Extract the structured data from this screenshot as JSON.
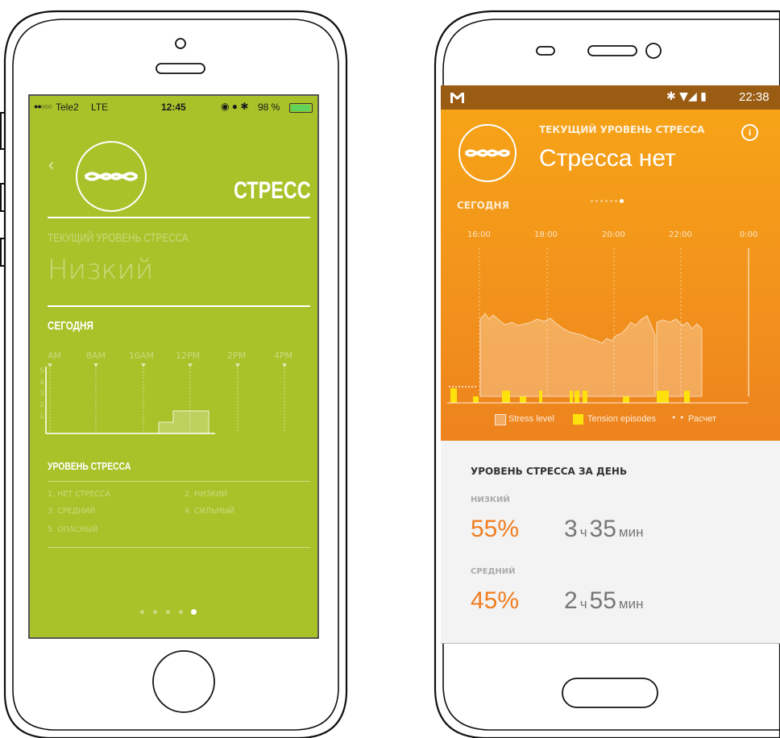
{
  "ios": {
    "status": {
      "carrier": "Tele2",
      "network": "LTE",
      "time": "12:45",
      "battery": "98 %"
    },
    "title": "СТРЕСС",
    "current_level_label": "ТЕКУЩИЙ УРОВЕНЬ СТРЕССА",
    "current_level_value": "Низкий",
    "today_label": "СЕГОДНЯ",
    "chart_time_labels": [
      "AM",
      "8AM",
      "10AM",
      "12PM",
      "2PM",
      "4PM"
    ],
    "chart_y_labels": [
      "5",
      "4",
      "3",
      "2",
      "1"
    ],
    "legend_title": "УРОВЕНЬ СТРЕССА",
    "legend_items": [
      "1. НЕТ СТРЕССА",
      "2. НИЗКИЙ",
      "3. СРЕДНИЙ",
      "4. СИЛЬНЫЙ",
      "5. ОПАСНЫЙ"
    ],
    "page_count": 5,
    "active_page": 5,
    "accent_color": "#a9c22a"
  },
  "android": {
    "status": {
      "time": "22:38"
    },
    "header_label": "ТЕКУЩИЙ УРОВЕНЬ СТРЕССА",
    "header_value": "Стресса нет",
    "today_label": "СЕГОДНЯ",
    "chart_time_labels": [
      "16:00",
      "18:00",
      "20:00",
      "22:00",
      "0:00"
    ],
    "legend": {
      "stress_level": "Stress level",
      "tension_episodes": "Tension episodes",
      "calculation": "Расчет"
    },
    "day_summary_title": "УРОВЕНЬ СТРЕССА ЗА ДЕНЬ",
    "levels": [
      {
        "name": "НИЗКИЙ",
        "percent": "55%",
        "hours": "3",
        "hours_unit": "ч",
        "minutes": "35",
        "minutes_unit": "мин"
      },
      {
        "name": "СРЕДНИЙ",
        "percent": "45%",
        "hours": "2",
        "hours_unit": "ч",
        "minutes": "55",
        "minutes_unit": "мин"
      }
    ],
    "page_dots": 7,
    "active_dot": 7,
    "accent_color": "#f39a1e",
    "percent_color": "#f07d1f"
  }
}
